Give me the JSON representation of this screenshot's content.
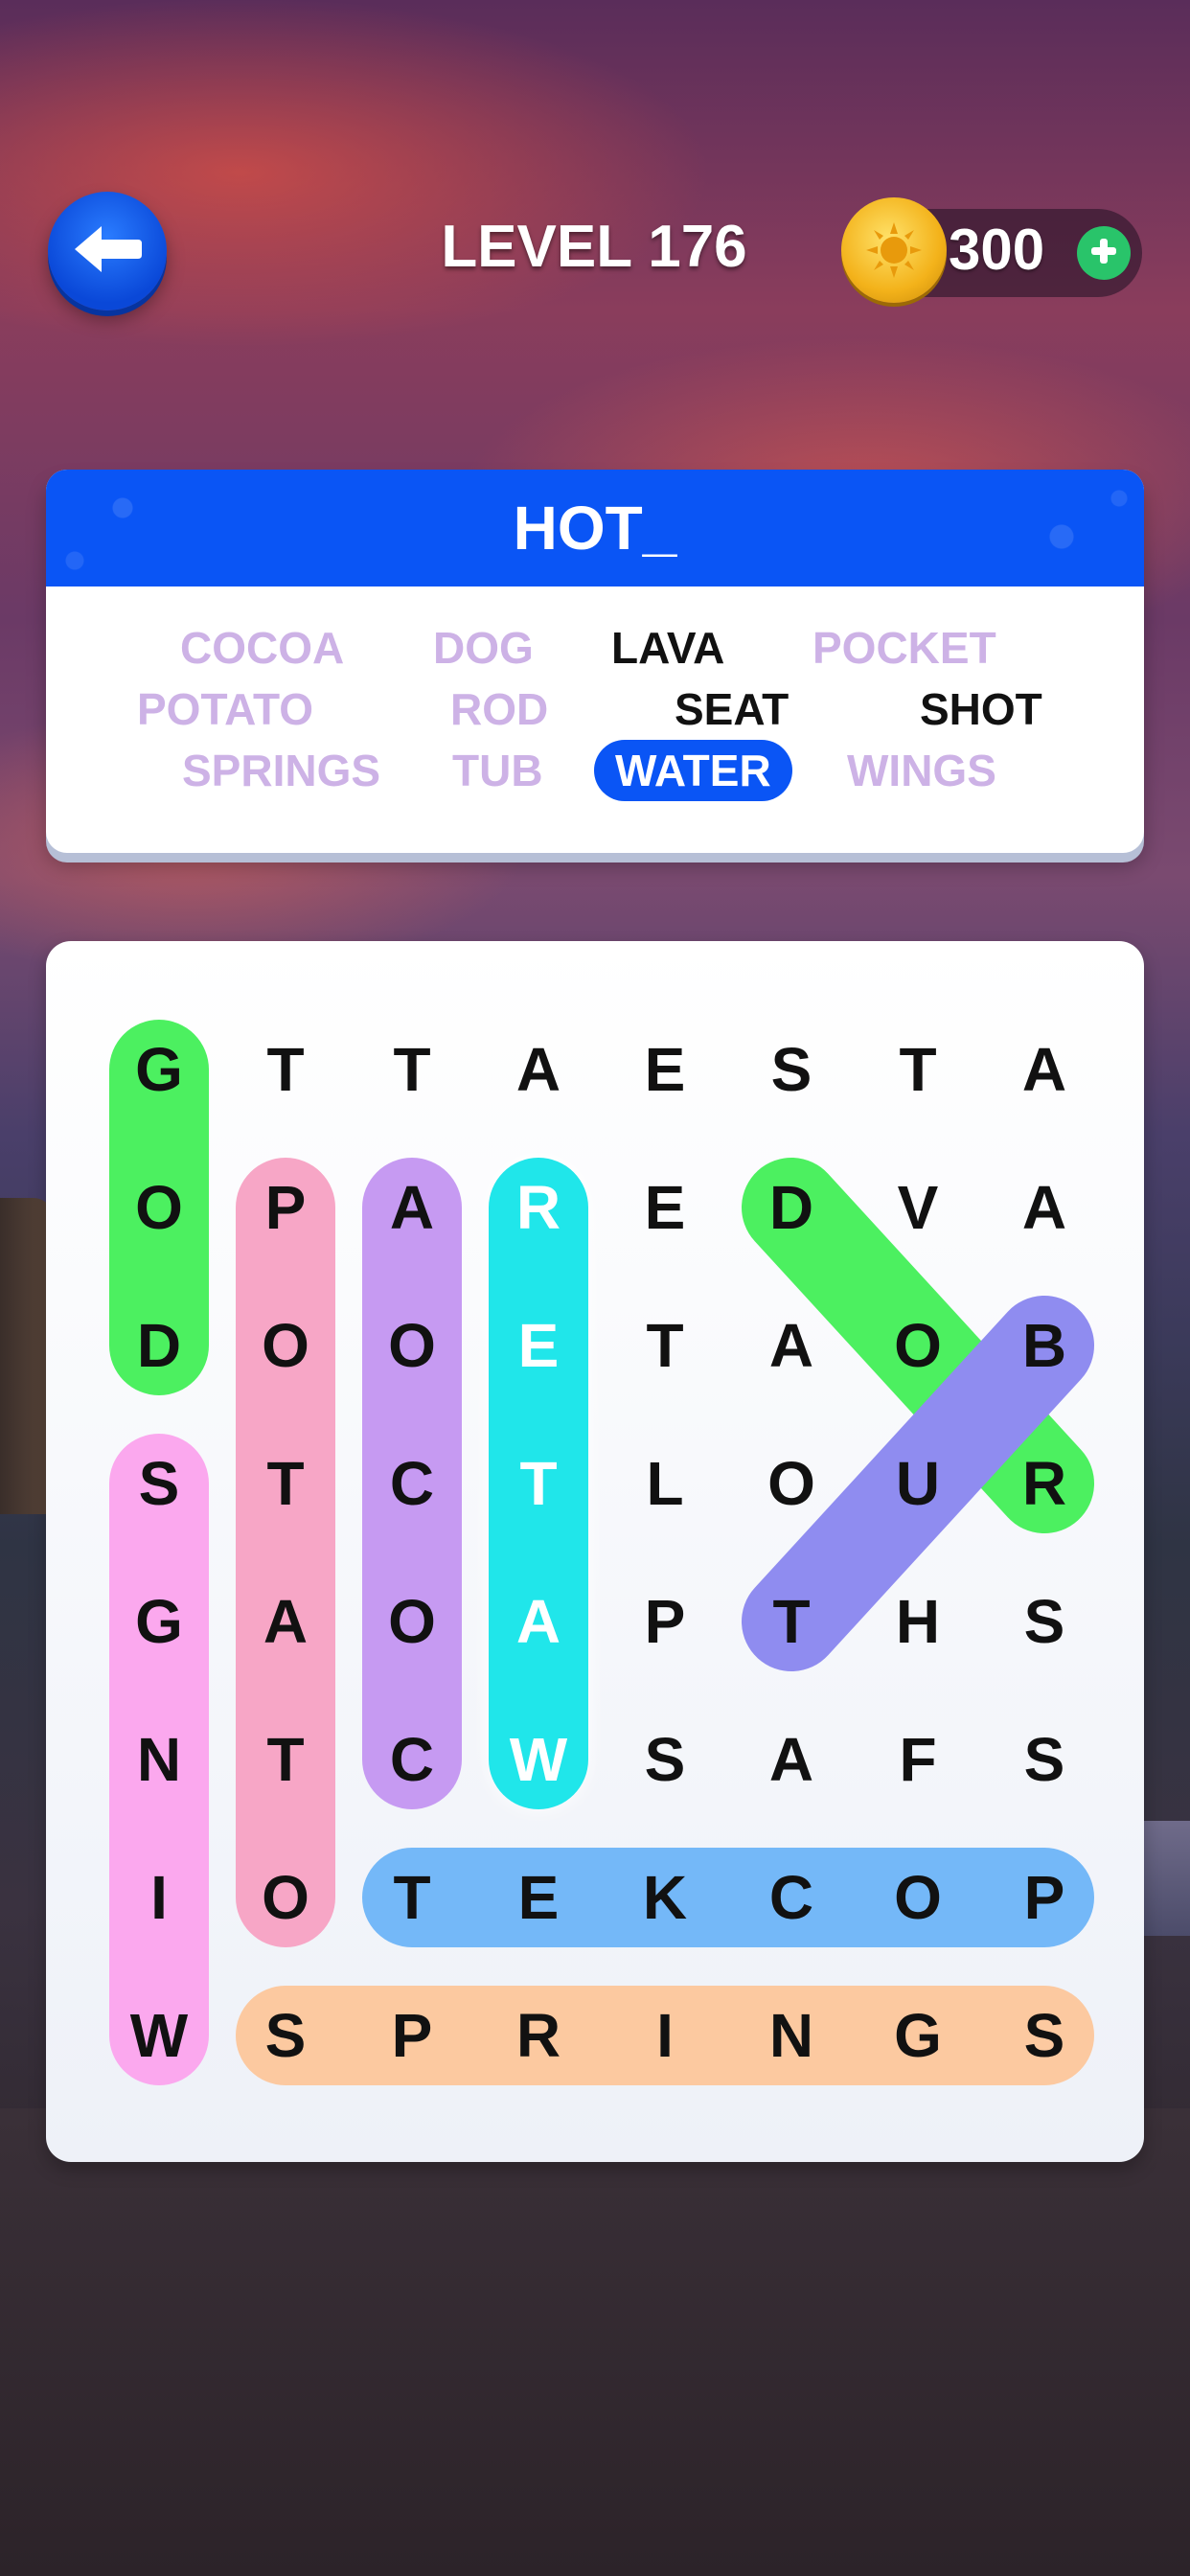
{
  "header": {
    "level_label": "LEVEL 176",
    "coins": "300"
  },
  "icons": {
    "back": "arrow-left-icon",
    "coin": "sun-coin-icon",
    "add": "plus-icon"
  },
  "colors": {
    "accent_blue": "#0a55f5",
    "found_word": "#cdb2e6",
    "plus_green": "#29c46a"
  },
  "puzzle": {
    "theme": "HOT_",
    "words": [
      {
        "text": "COCOA",
        "state": "found"
      },
      {
        "text": "DOG",
        "state": "found"
      },
      {
        "text": "LAVA",
        "state": "todo"
      },
      {
        "text": "POCKET",
        "state": "found"
      },
      {
        "text": "POTATO",
        "state": "found"
      },
      {
        "text": "ROD",
        "state": "found"
      },
      {
        "text": "SEAT",
        "state": "todo"
      },
      {
        "text": "SHOT",
        "state": "todo"
      },
      {
        "text": "SPRINGS",
        "state": "found"
      },
      {
        "text": "TUB",
        "state": "found"
      },
      {
        "text": "WATER",
        "state": "selected"
      },
      {
        "text": "WINGS",
        "state": "found"
      }
    ]
  },
  "grid": {
    "rows": [
      [
        "G",
        "T",
        "T",
        "A",
        "E",
        "S",
        "T",
        "A"
      ],
      [
        "O",
        "P",
        "A",
        "R",
        "E",
        "D",
        "V",
        "A"
      ],
      [
        "D",
        "O",
        "O",
        "E",
        "T",
        "A",
        "O",
        "B"
      ],
      [
        "S",
        "T",
        "C",
        "T",
        "L",
        "O",
        "U",
        "R"
      ],
      [
        "G",
        "A",
        "O",
        "A",
        "P",
        "T",
        "H",
        "S"
      ],
      [
        "N",
        "T",
        "C",
        "W",
        "S",
        "A",
        "F",
        "S"
      ],
      [
        "I",
        "O",
        "T",
        "E",
        "K",
        "C",
        "O",
        "P"
      ],
      [
        "W",
        "S",
        "P",
        "R",
        "I",
        "N",
        "G",
        "S"
      ]
    ],
    "highlights": [
      {
        "word": "DOG",
        "from": [
          2,
          0
        ],
        "to": [
          0,
          0
        ],
        "color": "#4cf060"
      },
      {
        "word": "WINGS",
        "from": [
          7,
          0
        ],
        "to": [
          3,
          0
        ],
        "color": "#fba8ee"
      },
      {
        "word": "POTATO",
        "from": [
          1,
          1
        ],
        "to": [
          6,
          1
        ],
        "color": "#f7a6c6"
      },
      {
        "word": "COCOA",
        "from": [
          5,
          2
        ],
        "to": [
          1,
          2
        ],
        "color": "#c69af2"
      },
      {
        "word": "WATER",
        "from": [
          5,
          3
        ],
        "to": [
          1,
          3
        ],
        "color": "#20e6ea"
      },
      {
        "word": "ROD",
        "from": [
          3,
          7
        ],
        "to": [
          1,
          5
        ],
        "color": "#4cf060"
      },
      {
        "word": "TUB",
        "from": [
          4,
          5
        ],
        "to": [
          2,
          7
        ],
        "color": "#8f8cf0"
      },
      {
        "word": "POCKET",
        "from": [
          6,
          7
        ],
        "to": [
          6,
          2
        ],
        "color": "#74b8f8"
      },
      {
        "word": "SPRINGS",
        "from": [
          7,
          1
        ],
        "to": [
          7,
          7
        ],
        "color": "#fcc9a0"
      }
    ]
  }
}
